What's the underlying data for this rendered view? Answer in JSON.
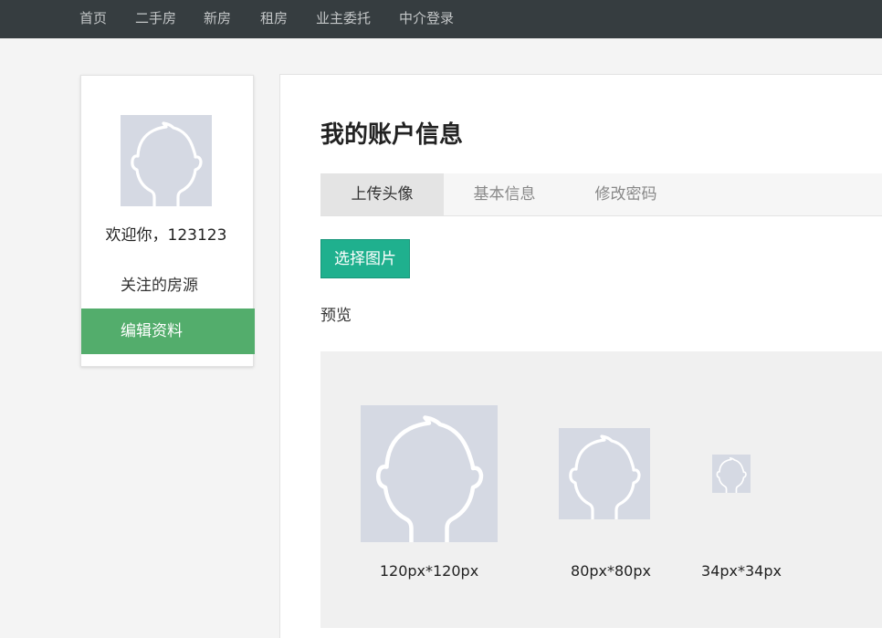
{
  "nav": {
    "items": [
      {
        "label": "首页"
      },
      {
        "label": "二手房"
      },
      {
        "label": "新房"
      },
      {
        "label": "租房"
      },
      {
        "label": "业主委托"
      },
      {
        "label": "中介登录"
      }
    ]
  },
  "sidebar": {
    "avatar_icon": "default-user-avatar-icon",
    "welcome": "欢迎你，123123",
    "links": {
      "follow": "关注的房源",
      "edit": "编辑资料"
    }
  },
  "main": {
    "title": "我的账户信息",
    "tabs": [
      {
        "label": "上传头像",
        "active": true
      },
      {
        "label": "基本信息",
        "active": false
      },
      {
        "label": "修改密码",
        "active": false
      }
    ],
    "select_button": "选择图片",
    "preview_label": "预览",
    "previews": [
      {
        "caption": "120px*120px"
      },
      {
        "caption": "80px*80px"
      },
      {
        "caption": "34px*34px"
      }
    ]
  },
  "colors": {
    "nav_bg": "#363d40",
    "sidebar_active": "#53ad6c",
    "primary_button": "#1fb08e",
    "avatar_bg": "#d5d9e3"
  }
}
